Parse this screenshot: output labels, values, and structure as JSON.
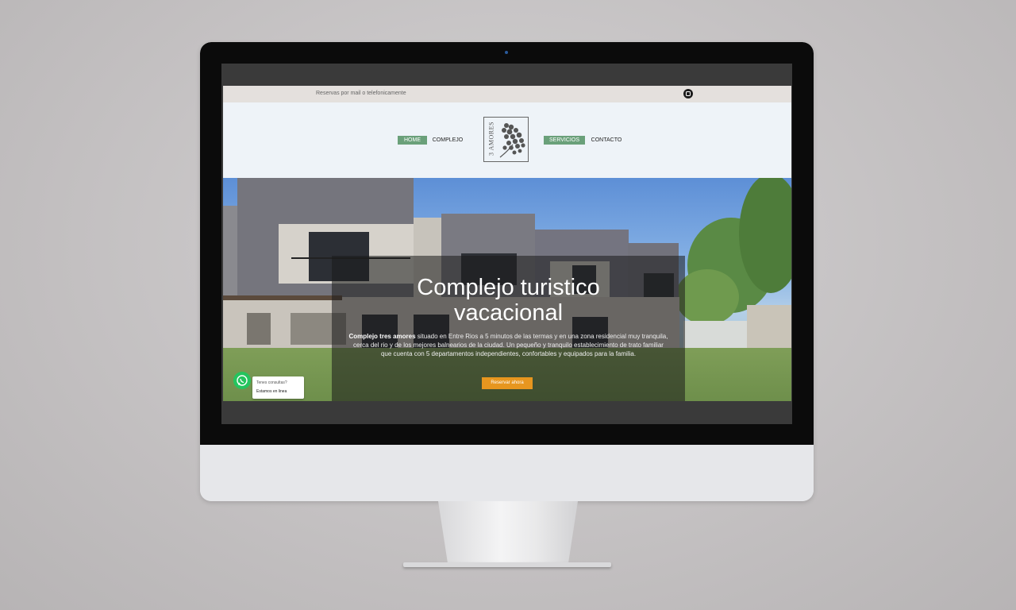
{
  "topbar": {
    "text": "Reservas por mail o telefonicamente",
    "social_icon": "instagram-icon"
  },
  "nav": {
    "items": [
      {
        "label": "HOME",
        "active": true
      },
      {
        "label": "COMPLEJO",
        "active": false
      },
      {
        "label": "SERVICIOS",
        "active": true
      },
      {
        "label": "CONTACTO",
        "active": false
      }
    ],
    "logo_text": "3 AMORES"
  },
  "hero": {
    "title_line1": "Complejo turistico",
    "title_line2": "vacacional",
    "desc_bold": "Complejo tres amores",
    "desc_rest": " situado en Entre Rios a 5 minutos de las termas y en una zona residencial muy tranquila, cerca del rio y de los mejores balnearios de la ciudad. Un pequeño y tranquilo establecimiento de trato familiar que cuenta con 5 departamentos independientes, confortables y equipados para la familia.",
    "cta_label": "Reservar ahora"
  },
  "whatsapp": {
    "question": "Tenes consultas?",
    "status": "Estamos en linea"
  },
  "colors": {
    "nav_active": "#6aa07a",
    "cta": "#e7961f",
    "topbar_bg": "#e4e0dd",
    "whatsapp": "#24c45e"
  }
}
